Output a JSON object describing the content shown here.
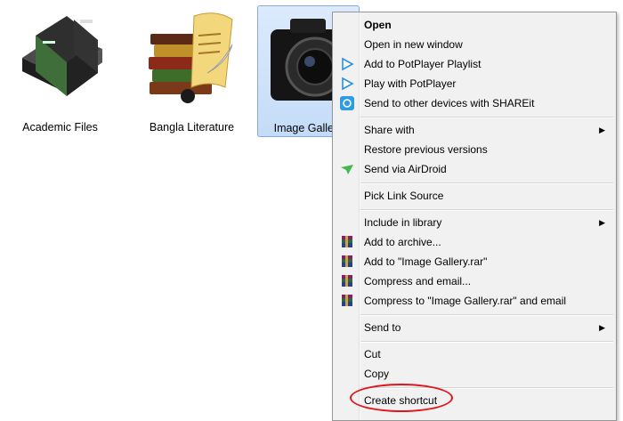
{
  "folders": [
    {
      "label": "Academic Files",
      "icon": "books-icon"
    },
    {
      "label": "Bangla Literature",
      "icon": "literature-books-icon"
    },
    {
      "label": "Image Gallery",
      "icon": "camera-icon",
      "selected": true
    }
  ],
  "colors": {
    "selection": "#c4dcf8",
    "highlight_circle": "#e0161c",
    "menu_bg": "#f1f1f1"
  },
  "menu": {
    "open": "Open",
    "open_new_window": "Open in new window",
    "add_potplayer_playlist": "Add to PotPlayer Playlist",
    "play_potplayer": "Play with PotPlayer",
    "shareit": "Send to other devices with SHAREit",
    "share_with": "Share with",
    "restore_versions": "Restore previous versions",
    "airdroid": "Send via AirDroid",
    "pick_link_source": "Pick Link Source",
    "include_library": "Include in library",
    "add_archive": "Add to archive...",
    "add_rar": "Add to \"Image Gallery.rar\"",
    "compress_email": "Compress and email...",
    "compress_rar_email": "Compress to \"Image Gallery.rar\" and email",
    "send_to": "Send to",
    "cut": "Cut",
    "copy": "Copy",
    "create_shortcut": "Create shortcut",
    "submenu_arrow": "▶"
  }
}
